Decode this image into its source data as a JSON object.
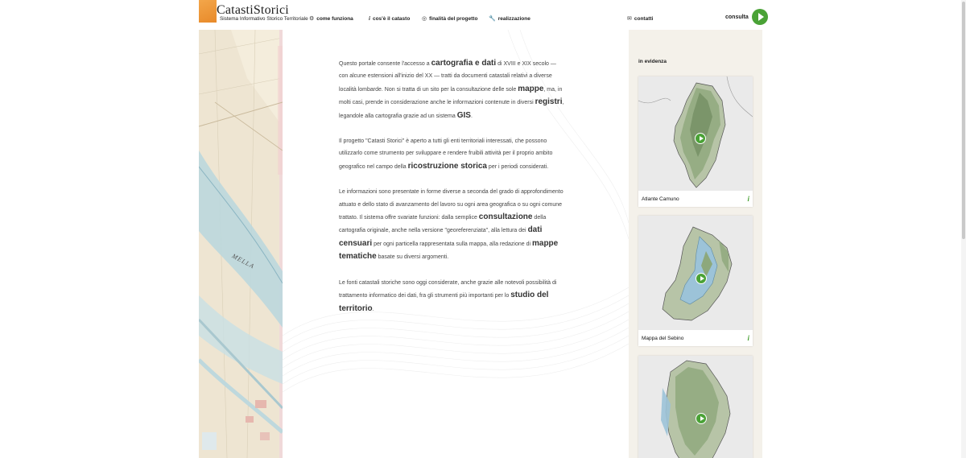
{
  "header": {
    "logo_title": "CatastiStorici",
    "logo_subtitle": "Sistema Informativo Storico Territoriale",
    "nav": [
      {
        "label": "come funziona",
        "icon": "gears-icon"
      },
      {
        "label": "cos'è il catasto",
        "icon": "info-icon"
      },
      {
        "label": "finalità del progetto",
        "icon": "target-icon"
      },
      {
        "label": "realizzazione",
        "icon": "wrench-icon"
      },
      {
        "label": "contatti",
        "icon": "envelope-icon"
      }
    ],
    "consulta_label": "consulta"
  },
  "main": {
    "p1": {
      "a": "Questo portale consente l'accesso a ",
      "b1": "cartografia e dati",
      "c": " di XVIII e XIX secolo — con alcune estensioni all'inizio del XX — tratti da documenti catastali relativi a diverse località lombarde. Non si tratta di un sito per la consultazione delle sole ",
      "b2": "mappe",
      "d": ", ma, in molti casi, prende in considerazione anche le informazioni contenute in diversi ",
      "b3": "registri",
      "e": ", legandole alla cartografia grazie ad un sistema ",
      "b4": "GIS",
      "f": "."
    },
    "p2": {
      "a": "Il progetto \"Catasti Storici\" è aperto a tutti gli enti territoriali interessati, che possono utilizzarlo come strumento per sviluppare e rendere fruibili attività per il proprio ambito geografico nel campo della ",
      "b1": "ricostruzione storica",
      "c": " per i periodi considerati."
    },
    "p3": {
      "a": "Le informazioni sono presentate in forme diverse a seconda del grado di approfondimento attuato e dello stato di avanzamento del lavoro su ogni area geografica o su ogni comune trattato. Il sistema offre svariate funzioni: dalla semplice ",
      "b1": "consultazione",
      "c": " della cartografia originale, anche nella versione \"georeferenziata\", alla lettura dei ",
      "b2": "dati censuari",
      "d": " per ogni particella rappresentata sulla mappa, alla redazione di ",
      "b3": "mappe tematiche",
      "e": " basate su diversi argomenti."
    },
    "p4": {
      "a": "Le fonti catastali storiche sono oggi considerate, anche grazie alle notevoli possibilità di trattamento informatico dei dati, fra gli strumenti più importanti per lo ",
      "b1": "studio del territorio",
      "c": "."
    }
  },
  "map_label": "MELLA",
  "sidebar": {
    "title": "in evidenza",
    "cards": [
      {
        "caption": "Atlante Camuno",
        "info": "i"
      },
      {
        "caption": "Mappa del Sebino",
        "info": "i"
      },
      {
        "caption": "",
        "info": ""
      }
    ]
  },
  "colors": {
    "accent": "#4aa236",
    "logo": "#e88a2a",
    "sidebar_bg": "#f4f1ea",
    "map_bg": "#efe6d4"
  }
}
